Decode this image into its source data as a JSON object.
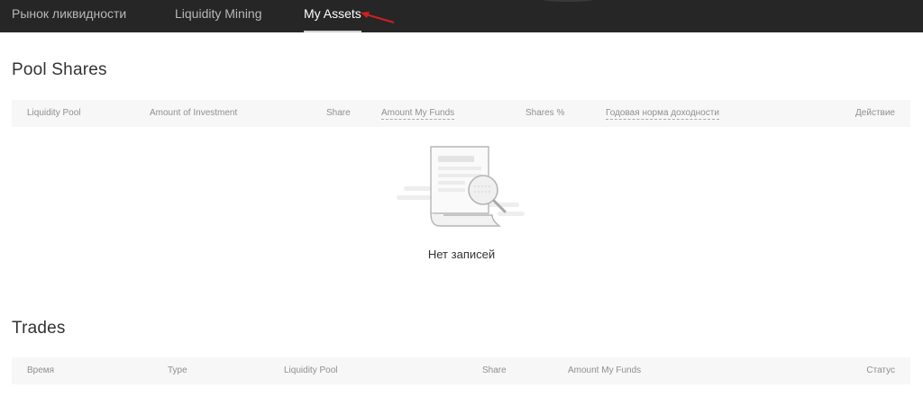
{
  "nav": {
    "tabs": [
      {
        "label": "Рынок ликвидности",
        "active": false
      },
      {
        "label": "Liquidity Mining",
        "active": false
      },
      {
        "label": "My Assets",
        "active": true
      }
    ]
  },
  "pool_shares": {
    "title": "Pool Shares",
    "columns": [
      "Liquidity Pool",
      "Amount of Investment",
      "Share",
      "Amount My Funds",
      "Shares %",
      "Годовая норма доходности",
      "Действие"
    ],
    "empty_text": "Нет записей"
  },
  "trades": {
    "title": "Trades",
    "columns": [
      "Время",
      "Type",
      "Liquidity Pool",
      "Share",
      "Amount My Funds",
      "Статус"
    ]
  },
  "colors": {
    "nav_bg": "#262626",
    "arrow": "#d11f1f",
    "table_header_bg": "#f7f7f7"
  }
}
